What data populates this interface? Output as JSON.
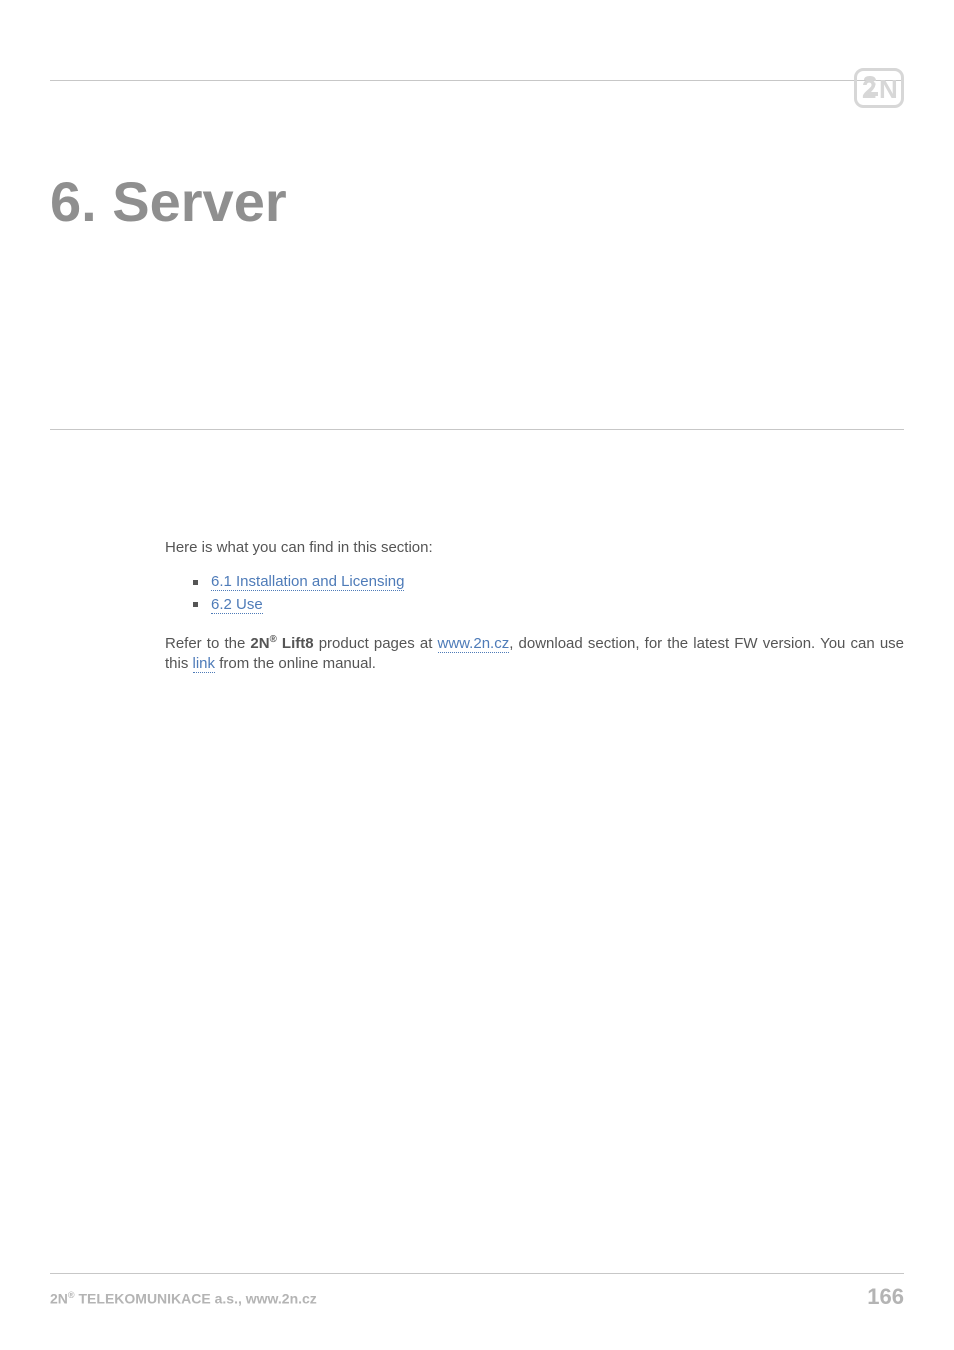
{
  "header": {
    "logo_label": "2N"
  },
  "title": "6. Server",
  "content": {
    "intro": "Here is what you can find in this section:",
    "bullets": [
      {
        "label": "6.1 Installation and Licensing"
      },
      {
        "label": "6.2 Use"
      }
    ],
    "refer_pre": "Refer to the ",
    "brand_name": "2N",
    "brand_product": " Lift8",
    "refer_mid1": " product pages at ",
    "url_text": "www.2n.cz",
    "refer_mid2": ", download section, for the latest FW version. You can use this ",
    "link_text": "link",
    "refer_end": " from the online manual."
  },
  "footer": {
    "company_pre": "2N",
    "company_post": " TELEKOMUNIKACE a.s., www.2n.cz",
    "page_number": "166"
  }
}
